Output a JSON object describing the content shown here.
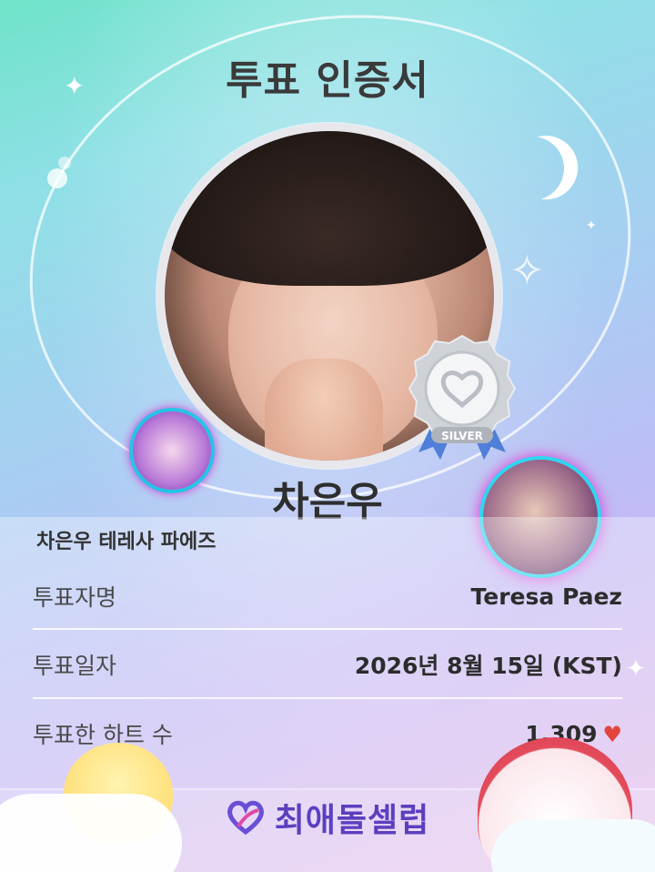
{
  "header": {
    "title": "투표 인증서"
  },
  "idol": {
    "name": "차은우"
  },
  "badge": {
    "tier": "SILVER"
  },
  "dedication": {
    "text": "차은우 테레사 파에즈"
  },
  "details": {
    "voter_label": "투표자명",
    "voter_value": "Teresa Paez",
    "date_label": "투표일자",
    "date_value": "2026년 8월 15일 (KST)",
    "hearts_label": "투표한 하트 수",
    "hearts_value": "1,309"
  },
  "footer": {
    "brand": "최애돌셀럽"
  },
  "colors": {
    "heart": "#e2453c",
    "brand": "#5b3fbf",
    "badge_ribbon": "#4f7fd8"
  },
  "icons": [
    "moon-icon",
    "sparkle-icon",
    "heart-icon",
    "silver-badge-icon",
    "brand-logo-icon"
  ]
}
